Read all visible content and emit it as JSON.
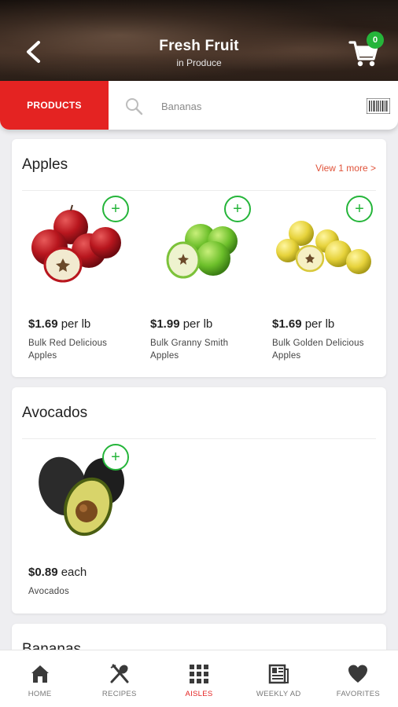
{
  "header": {
    "title": "Fresh Fruit",
    "subtitle": "in Produce",
    "cart_count": "0"
  },
  "search": {
    "tab_label": "PRODUCTS",
    "placeholder": "Bananas",
    "value": ""
  },
  "sections": [
    {
      "title": "Apples",
      "view_more": "View 1 more >",
      "products": [
        {
          "price": "$1.69",
          "unit": "per lb",
          "name": "Bulk Red Delicious Apples",
          "image": "red-apples"
        },
        {
          "price": "$1.99",
          "unit": "per lb",
          "name": "Bulk Granny Smith Apples",
          "image": "green-apples"
        },
        {
          "price": "$1.69",
          "unit": "per lb",
          "name": "Bulk Golden Delicious Apples",
          "image": "golden-apples"
        }
      ]
    },
    {
      "title": "Avocados",
      "products": [
        {
          "price": "$0.89",
          "unit": "each",
          "name": "Avocados",
          "image": "avocados"
        }
      ]
    },
    {
      "title": "Bananas"
    }
  ],
  "bottom_nav": [
    {
      "label": "HOME",
      "icon": "home-icon",
      "active": false
    },
    {
      "label": "RECIPES",
      "icon": "fork-spoon-icon",
      "active": false
    },
    {
      "label": "AISLES",
      "icon": "grid-icon",
      "active": true
    },
    {
      "label": "WEEKLY AD",
      "icon": "newspaper-icon",
      "active": false
    },
    {
      "label": "FAVORITES",
      "icon": "heart-icon",
      "active": false
    }
  ],
  "colors": {
    "brand_red": "#e42322",
    "add_green": "#25b53a",
    "link_orange": "#e0533a"
  }
}
